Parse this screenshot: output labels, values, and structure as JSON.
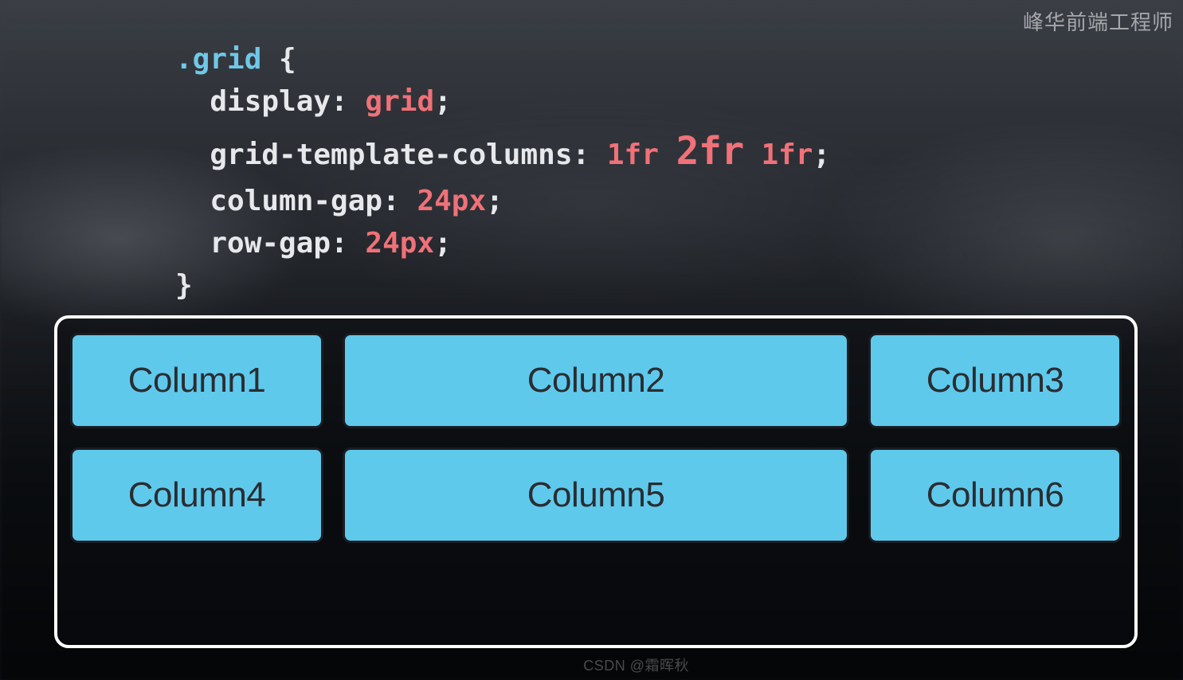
{
  "watermark": {
    "top": "峰华前端工程师",
    "bottom": "CSDN @霜晖秋"
  },
  "code": {
    "selector": ".grid",
    "open_brace": " {",
    "close_brace": "}",
    "lines": [
      {
        "prop": "display",
        "value": "grid",
        "big": false
      },
      {
        "prop": "grid-template-columns",
        "value_parts": [
          "1fr ",
          "2fr",
          " 1fr"
        ],
        "big_index": 1
      },
      {
        "prop": "column-gap",
        "value": "24px",
        "big": false
      },
      {
        "prop": "row-gap",
        "value": "24px",
        "big": false
      }
    ]
  },
  "grid": {
    "cells": [
      "Column1",
      "Column2",
      "Column3",
      "Column4",
      "Column5",
      "Column6"
    ]
  }
}
